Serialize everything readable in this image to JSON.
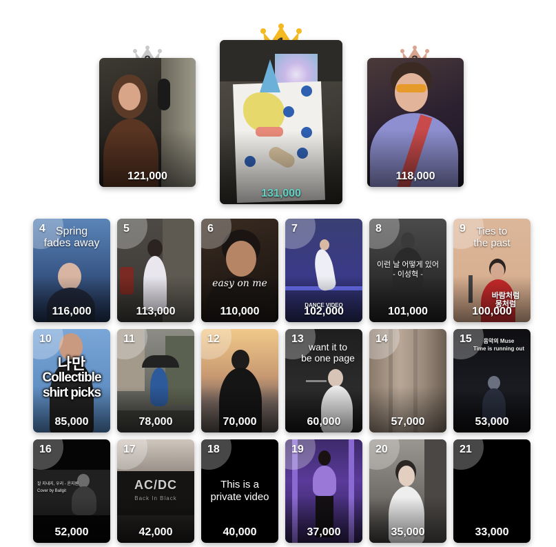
{
  "podium": [
    {
      "rank": "2",
      "count": "121,000",
      "crown_color": "#bfbfbf"
    },
    {
      "rank": "1",
      "count": "131,000",
      "crown_color": "#f5b921"
    },
    {
      "rank": "3",
      "count": "118,000",
      "crown_color": "#d6a088"
    }
  ],
  "grid": [
    {
      "rank": "4",
      "count": "116,000",
      "overlay": "Spring\nfades away"
    },
    {
      "rank": "5",
      "count": "113,000",
      "overlay": ""
    },
    {
      "rank": "6",
      "count": "110,000",
      "overlay": "easy on me"
    },
    {
      "rank": "7",
      "count": "102,000",
      "overlay": "DANCE VIDEO"
    },
    {
      "rank": "8",
      "count": "101,000",
      "overlay": "이런 날 어떻게 있어\n- 이성혁 -"
    },
    {
      "rank": "9",
      "count": "100,000",
      "overlay": "Ties to\nthe past",
      "overlay2": "바람처럼\n몽처럼"
    },
    {
      "rank": "10",
      "count": "85,000",
      "overlay": "Collectible\nshirt picks",
      "overlay2": "나만"
    },
    {
      "rank": "11",
      "count": "78,000",
      "overlay": ""
    },
    {
      "rank": "12",
      "count": "70,000",
      "overlay": ""
    },
    {
      "rank": "13",
      "count": "60,000",
      "overlay": "want it to\nbe one page"
    },
    {
      "rank": "14",
      "count": "57,000",
      "overlay": ""
    },
    {
      "rank": "15",
      "count": "53,000",
      "overlay": "음악의 Muse\nTime is running out"
    },
    {
      "rank": "16",
      "count": "52,000",
      "overlay": "잘 지내지, 우리 - 윤지원\nCover by Ballgit"
    },
    {
      "rank": "17",
      "count": "42,000",
      "overlay": "AC/DC",
      "overlay2": "Back In Black"
    },
    {
      "rank": "18",
      "count": "40,000",
      "overlay": "This is a\nprivate video"
    },
    {
      "rank": "19",
      "count": "37,000",
      "overlay": ""
    },
    {
      "rank": "20",
      "count": "35,000",
      "overlay": ""
    },
    {
      "rank": "21",
      "count": "33,000",
      "overlay": ""
    }
  ]
}
